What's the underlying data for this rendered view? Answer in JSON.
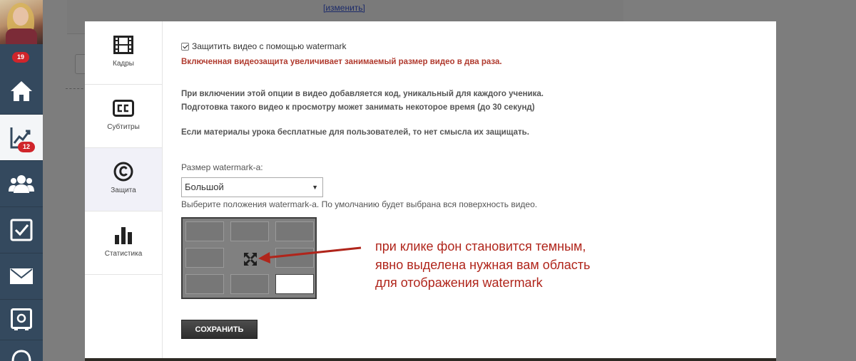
{
  "sidebar": {
    "notifications_badge": "19",
    "analytics_badge": "12",
    "items": [
      {
        "name": "home"
      },
      {
        "name": "analytics"
      },
      {
        "name": "users"
      },
      {
        "name": "tasks"
      },
      {
        "name": "mail"
      },
      {
        "name": "safe"
      }
    ]
  },
  "background": {
    "change_link": "[изменить]"
  },
  "modal": {
    "tabs": [
      {
        "label": "Кадры",
        "icon": "film-icon"
      },
      {
        "label": "Субтитры",
        "icon": "cc-icon"
      },
      {
        "label": "Защита",
        "icon": "copyright-icon",
        "active": true
      },
      {
        "label": "Статистика",
        "icon": "bar-chart-icon"
      }
    ],
    "protect_checkbox_label": "Защитить видео с помощью watermark",
    "protect_checked": true,
    "warning": "Включенная видеозащита увеличивает занимаемый размер видео в два раза.",
    "info_line1": "При включении этой опции в видео добавляется код, уникальный для каждого ученика.",
    "info_line2": "Подготовка такого видео к просмотру может занимать некоторое время (до 30 секунд)",
    "info_line3": "Если материалы урока бесплатные для пользователей, то нет смысла их защищать.",
    "size_label": "Размер watermark-a:",
    "size_value": "Большой",
    "position_hint": "Выберите положения watermark-a. По умолчанию будет выбрана вся поверхность видео.",
    "selected_cell": 8,
    "save_label": "СОХРАНИТЬ"
  },
  "annotation": {
    "line1": "при клике фон становится темным,",
    "line2": "явно выделена нужная вам область",
    "line3": "для отображения watermark",
    "color": "#b0251b"
  }
}
